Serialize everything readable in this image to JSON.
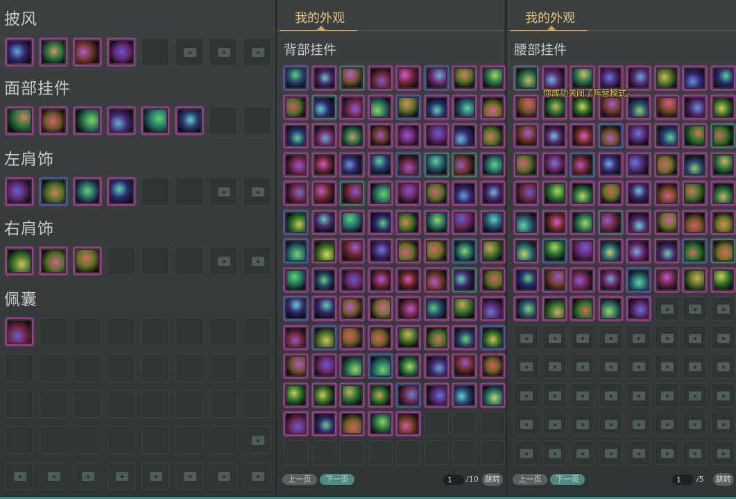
{
  "left": {
    "sections": [
      {
        "title": "披风",
        "slots": [
          "I",
          "I",
          "I",
          "I",
          "E",
          "L",
          "L",
          "L"
        ]
      },
      {
        "title": "面部挂件",
        "slots": [
          "I",
          "I",
          "I",
          "I",
          "I",
          "I",
          "E",
          "E"
        ]
      },
      {
        "title": "左肩饰",
        "slots": [
          "I",
          "I",
          "I",
          "I",
          "E",
          "E",
          "L",
          "L"
        ]
      },
      {
        "title": "右肩饰",
        "slots": [
          "I",
          "I",
          "I",
          "E",
          "E",
          "E",
          "L",
          "L"
        ]
      },
      {
        "title": "佩囊",
        "slots": [
          "I",
          "E",
          "E",
          "E",
          "E",
          "E",
          "E",
          "E"
        ]
      }
    ],
    "extra_rows": [
      [
        "E",
        "E",
        "E",
        "E",
        "E",
        "E",
        "E",
        "E"
      ],
      [
        "E",
        "E",
        "E",
        "E",
        "E",
        "E",
        "E",
        "E"
      ],
      [
        "E",
        "E",
        "E",
        "E",
        "E",
        "E",
        "E",
        "L"
      ],
      [
        "L",
        "L",
        "L",
        "L",
        "L",
        "L",
        "L",
        "L"
      ]
    ]
  },
  "middle": {
    "tab": "我的外观",
    "header": "背部挂件",
    "item_count": 101,
    "total_slots": 112,
    "locked_from": 112,
    "pager": {
      "prev": "上一页",
      "next": "下一页",
      "page": "1",
      "total": "/10",
      "jump": "跳转"
    }
  },
  "right": {
    "tab": "我的外观",
    "header": "腰部挂件",
    "item_count": 69,
    "total_slots": 112,
    "locked_from": 69,
    "pager": {
      "prev": "上一页",
      "next": "下一页",
      "page": "1",
      "total": "/5",
      "jump": "跳转"
    }
  },
  "toast": "你成功关闭了阵营模式。",
  "colors": {
    "item_border": "#a6358f",
    "accent": "#c9a15d",
    "next_button": "#4f8a80",
    "toast": "#d8d21e"
  }
}
